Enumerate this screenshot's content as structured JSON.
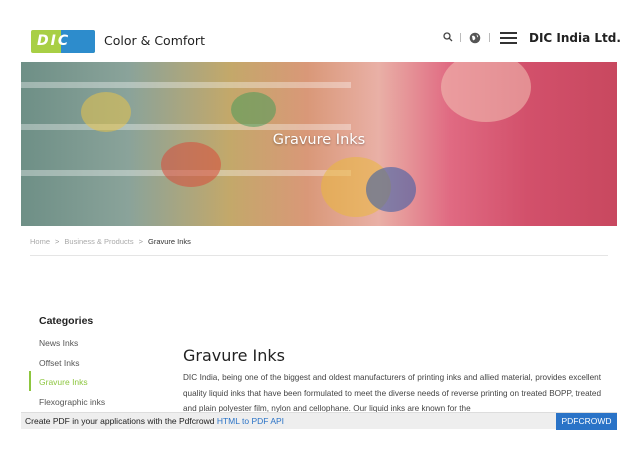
{
  "header": {
    "logo_text": "DIC",
    "tagline": "Color & Comfort",
    "company": "DIC India Ltd.",
    "icons": [
      "search-icon",
      "globe-icon",
      "menu-icon"
    ]
  },
  "hero": {
    "title": "Gravure Inks"
  },
  "breadcrumb": {
    "items": [
      "Home",
      "Business & Products",
      "Gravure Inks"
    ],
    "separator": ">"
  },
  "sidebar": {
    "title": "Categories",
    "items": [
      {
        "label": "News Inks"
      },
      {
        "label": "Offset Inks"
      },
      {
        "label": "Gravure Inks",
        "active": true
      },
      {
        "label": "Flexographic inks"
      }
    ]
  },
  "main": {
    "title": "Gravure Inks",
    "body": "DIC India, being one of the biggest and oldest manufacturers of printing inks and allied material, provides excellent quality liquid inks that have been formulated to meet the diverse needs of reverse printing on treated BOPP, treated and plain polyester film, nylon and cellophane. Our liquid inks are known for the"
  },
  "pdfbar": {
    "text": "Create PDF in your applications with the Pdfcrowd ",
    "link": "HTML to PDF API",
    "button": "PDFCROWD"
  },
  "colors": {
    "accent": "#8dc63f",
    "link": "#2a73c7",
    "logo_green": "#a8cf45",
    "logo_blue": "#2d8ccc"
  }
}
